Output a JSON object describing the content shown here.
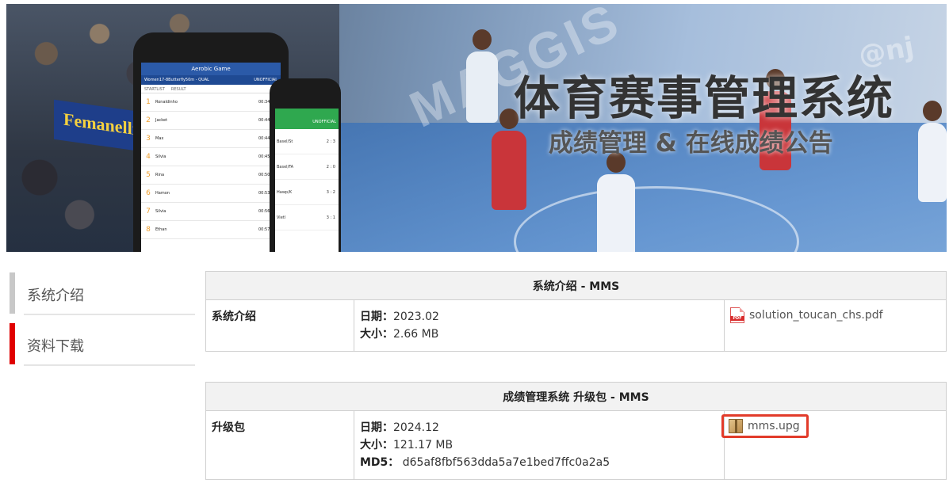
{
  "banner": {
    "title": "体育赛事管理系统",
    "subtitle": "成绩管理 & 在线成绩公告",
    "phone_main": {
      "app_title": "Aerobic Game",
      "event": "Women17-8Butterfly50m - QUAL",
      "status": "UNOFFICIAL",
      "tabs": [
        "STARTLIST",
        "RESULT"
      ],
      "rows": [
        {
          "rank": "1",
          "name": "Ronaldinho",
          "time": "00:34.23"
        },
        {
          "rank": "2",
          "name": "Jacket",
          "time": "00:44.10"
        },
        {
          "rank": "3",
          "name": "Max",
          "time": "00:44.98"
        },
        {
          "rank": "4",
          "name": "Silvia",
          "time": "00:45.60"
        },
        {
          "rank": "5",
          "name": "Rina",
          "time": "00:50.60"
        },
        {
          "rank": "6",
          "name": "Hamon",
          "time": "00:53.56"
        },
        {
          "rank": "7",
          "name": "Silvia",
          "time": "00:56.51"
        },
        {
          "rank": "8",
          "name": "Ethan",
          "time": "00:57.86"
        }
      ]
    },
    "phone_side": {
      "status": "UNOFFICIAL",
      "rows": [
        {
          "name": "Basel/St",
          "score": "2 : 3"
        },
        {
          "name": "Basel/FA",
          "score": "2 : 0"
        },
        {
          "name": "Hawp/K",
          "score": "3 : 2"
        },
        {
          "name": "Vietl",
          "score": "3 : 1"
        }
      ]
    },
    "wall_text": "MAGGIS",
    "brand_board": "Femanelli",
    "handle": "@nj"
  },
  "sidebar": {
    "items": [
      {
        "label": "系统介绍",
        "active": false
      },
      {
        "label": "资料下载",
        "active": true
      }
    ]
  },
  "downloads": [
    {
      "header": "系统介绍 - MMS",
      "label": "系统介绍",
      "date_label": "日期：",
      "date": "2023.02",
      "size_label": "大小：",
      "size": "2.66 MB",
      "file": "solution_toucan_chs.pdf",
      "file_icon": "pdf-file-icon"
    },
    {
      "header": "成绩管理系统 升级包 - MMS",
      "label": "升级包",
      "date_label": "日期：",
      "date": "2024.12",
      "size_label": "大小：",
      "size": "121.17 MB",
      "md5_label": "MD5：",
      "md5": "d65af8fbf563dda5a7e1bed7ffc0a2a5",
      "file": "mms.upg",
      "file_icon": "package-file-icon",
      "highlight_color": "#e23b2a"
    }
  ],
  "colors": {
    "active_bar": "#e00000",
    "inactive_bar": "#c8c8c8",
    "header_bg": "#f2f2f2"
  }
}
